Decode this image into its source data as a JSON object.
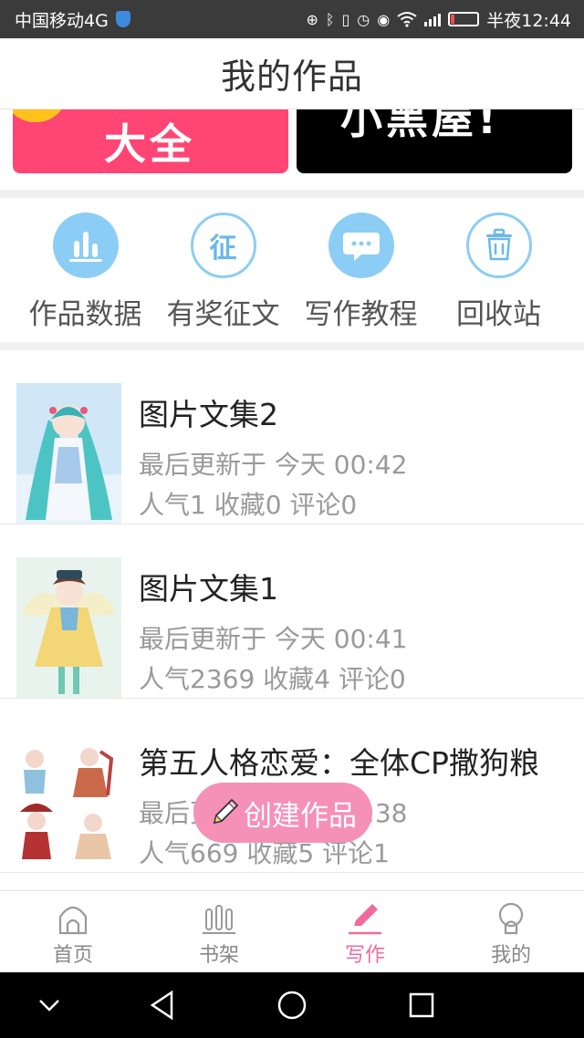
{
  "status_bar": {
    "carrier": "中国移动4G",
    "network_badge": "4G",
    "time": "半夜12:44",
    "icons": [
      "nfc-icon",
      "bluetooth-icon",
      "vibrate-icon",
      "alarm-icon",
      "eye-icon",
      "wifi-icon",
      "signal-icon",
      "battery-icon"
    ],
    "battery_level": 0.15
  },
  "header": {
    "title": "我的作品"
  },
  "banners": {
    "left_text": "大全",
    "right_text": "小黑屋!"
  },
  "quick_menu": [
    {
      "label": "作品数据",
      "icon": "bar-chart-icon"
    },
    {
      "label": "有奖征文",
      "icon_text": "征",
      "icon": "contest-icon"
    },
    {
      "label": "写作教程",
      "icon": "chat-bubble-icon"
    },
    {
      "label": "回收站",
      "icon": "trash-icon"
    }
  ],
  "works": [
    {
      "title": "图片文集2",
      "updated": "最后更新于 今天 00:42",
      "stats": "人气1 收藏0 评论0"
    },
    {
      "title": "图片文集1",
      "updated": "最后更新于 今天 00:41",
      "stats": "人气2369 收藏4 评论0"
    },
    {
      "title": "第五人格恋爱：全体CP撒狗粮",
      "updated": "最后更新于 今天 00:38",
      "stats": "人气669 收藏5 评论1"
    }
  ],
  "create_button": {
    "label": "创建作品"
  },
  "tab_bar": [
    {
      "label": "首页",
      "icon": "home-icon",
      "active": false
    },
    {
      "label": "书架",
      "icon": "bookshelf-icon",
      "active": false
    },
    {
      "label": "写作",
      "icon": "pencil-icon",
      "active": true
    },
    {
      "label": "我的",
      "icon": "profile-icon",
      "active": false
    }
  ],
  "colors": {
    "accent": "#f06a9c",
    "menu_icon": "#8ccdf5",
    "status_bar": "#3b3b3b"
  }
}
